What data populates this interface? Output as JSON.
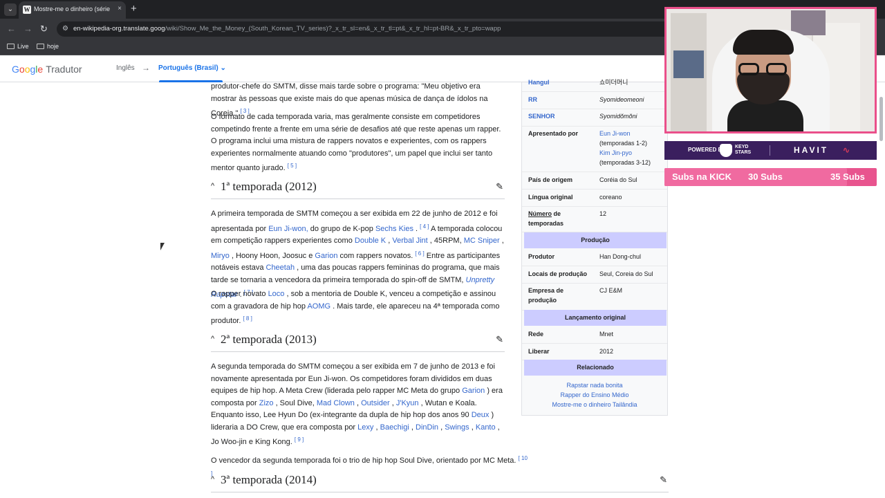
{
  "browser": {
    "tab_title": "Mostre-me o dinheiro (série de",
    "tab_favicon": "W",
    "tab_close": "×",
    "new_tab": "+",
    "tab_list_icon": "⌄",
    "url_host": "en-wikipedia-org.translate.goog",
    "url_path": "/wiki/Show_Me_the_Money_(South_Korean_TV_series)?_x_tr_sl=en&_x_tr_tl=pt&_x_tr_hl=pt-BR&_x_tr_pto=wapp",
    "bookmarks": [
      "Live",
      "hoje"
    ]
  },
  "translate_bar": {
    "logo_letters": [
      "G",
      "o",
      "o",
      "g",
      "l",
      "e"
    ],
    "product": "Tradutor",
    "source_lang": "Inglês",
    "arrow": "→",
    "target_lang": "Português (Brasil)",
    "target_chevron": "⌄"
  },
  "article": {
    "p0": {
      "t1": "produtor-chefe do SMTM, disse mais tarde sobre o programa: \"Meu objetivo era mostrar às pessoas que existe mais do que apenas música de dança de ídolos na Coreia.\"",
      "ref": "[ 3 ]"
    },
    "p1": {
      "t1": "O formato de cada temporada varia, mas geralmente consiste em competidores competindo frente a frente em uma série de desafios até que reste apenas um rapper. O programa inclui uma mistura de rappers novatos e experientes, com os rappers experientes normalmente atuando como \"produtores\", um papel que inclui ser tanto mentor quanto jurado.",
      "ref": "[ 5 ]"
    },
    "section1": "1ª temporada (2012)",
    "p2": {
      "t1": "A primeira temporada de SMTM começou a ser exibida em 22 de junho de 2012 e foi apresentada por",
      "l1": "Eun Ji-won,",
      "t2": "do grupo de K-pop",
      "l2": "Sechs Kies",
      "t3": ".",
      "ref1": "[ 4 ]",
      "t4": "A temporada colocou em competição rappers experientes como",
      "l3": "Double K",
      "t5": ",",
      "l4": "Verbal Jint",
      "t6": ", 45RPM,",
      "l5": "MC Sniper",
      "t7": ",",
      "l6": "Miryo",
      "t8": ", Hoony Hoon, Joosuc e",
      "l7": "Garion",
      "t9": "com rappers novatos.",
      "ref2": "[ 6 ]",
      "t10": "Entre as participantes notáveis estava",
      "l8": "Cheetah",
      "t11": ", uma das poucas rappers femininas do programa, que mais tarde se tornaria a vencedora da primeira temporada do spin-off de SMTM,",
      "l9": "Unpretty Rapstar",
      "t12": ".",
      "ref3": "[ 7 ]"
    },
    "p3": {
      "t1": "O rapper novato",
      "l1": "Loco",
      "t2": ", sob a mentoria de Double K, venceu a competição e assinou com a gravadora de hip hop",
      "l2": "AOMG",
      "t3": ". Mais tarde, ele apareceu na 4ª temporada como produtor.",
      "ref": "[ 8 ]"
    },
    "section2": "2ª temporada (2013)",
    "p4": {
      "t1": "A segunda temporada do SMTM começou a ser exibida em 7 de junho de 2013 e foi novamente apresentada por Eun Ji-won. Os competidores foram divididos em duas equipes de hip hop. A Meta Crew (liderada pelo rapper MC Meta do grupo",
      "l1": "Garion",
      "t2": ") era composta por",
      "l2": "Zizo",
      "t3": ", Soul Dive,",
      "l3": "Mad Clown",
      "t4": ",",
      "l4": "Outsider",
      "t5": ",",
      "l5": "J'Kyun",
      "t6": ", Wutan e Koala. Enquanto isso, Lee Hyun Do (ex-integrante da dupla de hip hop dos anos 90",
      "l6": "Deux",
      "t7": ") lideraria a DO Crew, que era composta por",
      "l7": "Lexy",
      "t8": ",",
      "l8": "Baechigi",
      "t9": ",",
      "l9": "DinDin",
      "t10": ",",
      "l10": "Swings",
      "t11": ",",
      "l11": "Kanto",
      "t12": ", Jo Woo-jin e King Kong.",
      "ref": "[ 9 ]"
    },
    "p5": {
      "t1": "O vencedor da segunda temporada foi o trio de hip hop Soul Dive, orientado por MC Meta.",
      "ref": "[ 10 ]"
    },
    "section3": "3ª temporada (2014)",
    "chevron_icon": "^",
    "edit_icon": "✎"
  },
  "infobox": {
    "rows": [
      {
        "label": "Hangul",
        "value": "쇼미더머니",
        "label_link": true
      },
      {
        "label": "RR",
        "value": "Syomideomeoni",
        "label_link": true
      },
      {
        "label": "SENHOR",
        "value": "Syomidŏmŏni",
        "label_link": true
      }
    ],
    "presenter_label": "Apresentado por",
    "presenter_1": "Eun Ji-won",
    "presenter_1_note": "(temporadas 1-2)",
    "presenter_2": "Kim Jin-pyo",
    "presenter_2_note": "(temporadas 3-12)",
    "country_label": "País de origem",
    "country_value": "Coréia do Sul",
    "lang_label": "Língua original",
    "lang_value": "coreano",
    "seasons_label_1": "Número",
    "seasons_label_2": "de temporadas",
    "seasons_value": "12",
    "prod_head": "Produção",
    "producer_label": "Produtor",
    "producer_value": "Han Dong-chul",
    "location_label": "Locais de produção",
    "location_value": "Seul, Coreia do Sul",
    "company_label": "Empresa de produção",
    "company_value": "CJ E&M",
    "release_head": "Lançamento original",
    "network_label": "Rede",
    "network_value": "Mnet",
    "release_label": "Liberar",
    "release_value": "2012",
    "related_head": "Relacionado",
    "related": [
      "Rapstar nada bonita",
      "Rapper do Ensino Médio",
      "Mostre-me o dinheiro Tailândia"
    ]
  },
  "overlay": {
    "powered_by": "POWERED BY",
    "brand_line1": "KEYD",
    "brand_line2": "STARS",
    "havit": "HAVIT",
    "subs_label": "Subs na KICK",
    "subs_current": "30 Subs",
    "subs_goal": "35 Subs",
    "subs_progress": 0.86
  },
  "colors": {
    "link": "#3366cc",
    "translate_accent": "#1a73e8",
    "infobox_header": "#ccccff",
    "overlay_pink": "#e8548e"
  }
}
